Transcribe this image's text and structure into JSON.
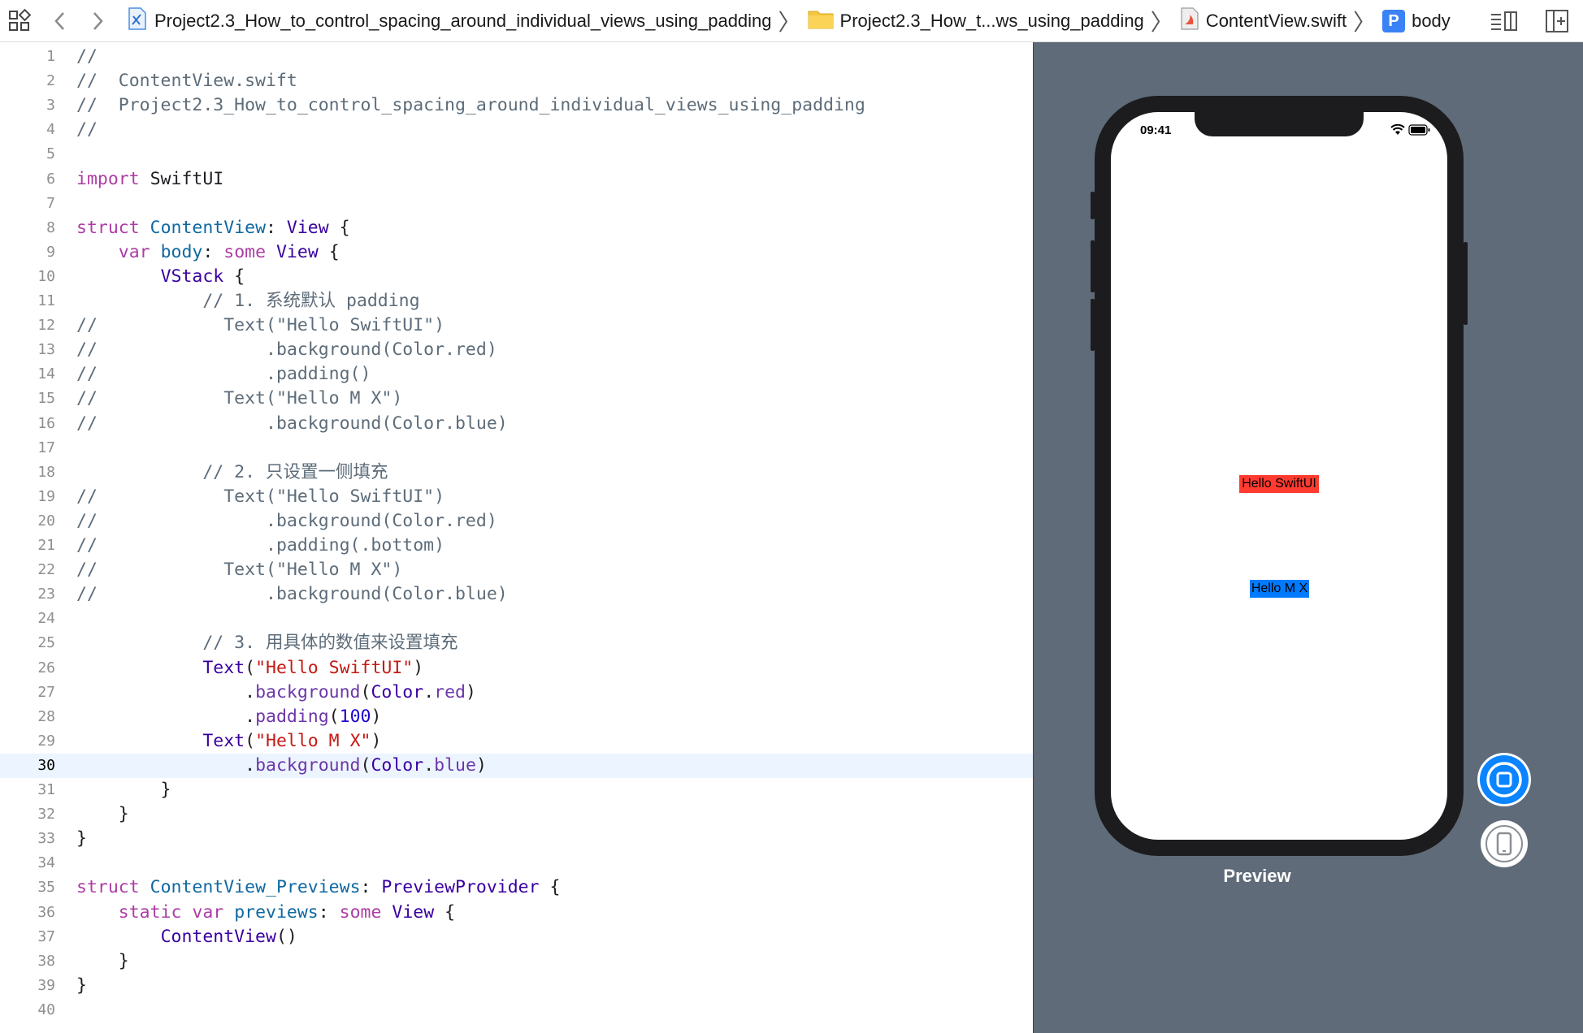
{
  "jumpbar": {
    "project": "Project2.3_How_to_control_spacing_around_individual_views_using_padding",
    "folder": "Project2.3_How_t...ws_using_padding",
    "file": "ContentView.swift",
    "symbol_badge": "P",
    "symbol": "body",
    "icons": [
      "grid-icon",
      "back-arrow-icon",
      "forward-arrow-icon",
      "xcode-project-icon",
      "folder-icon",
      "swift-file-icon",
      "property-icon",
      "editor-options-icon",
      "add-editor-icon"
    ]
  },
  "editor": {
    "current_line": 30,
    "lines": [
      {
        "n": "1",
        "t": [
          [
            "c",
            "//"
          ]
        ]
      },
      {
        "n": "2",
        "t": [
          [
            "c",
            "//  ContentView.swift"
          ]
        ]
      },
      {
        "n": "3",
        "t": [
          [
            "c",
            "//  Project2.3_How_to_control_spacing_around_individual_views_using_padding"
          ]
        ]
      },
      {
        "n": "4",
        "t": [
          [
            "c",
            "//"
          ]
        ]
      },
      {
        "n": "5",
        "t": []
      },
      {
        "n": "6",
        "t": [
          [
            "k",
            "import"
          ],
          [
            "p",
            " SwiftUI"
          ]
        ]
      },
      {
        "n": "7",
        "t": []
      },
      {
        "n": "8",
        "t": [
          [
            "k",
            "struct"
          ],
          [
            "p",
            " "
          ],
          [
            "d",
            "ContentView"
          ],
          [
            "p",
            ": "
          ],
          [
            "t",
            "View"
          ],
          [
            "p",
            " {"
          ]
        ]
      },
      {
        "n": "9",
        "t": [
          [
            "p",
            "    "
          ],
          [
            "k",
            "var"
          ],
          [
            "p",
            " "
          ],
          [
            "d",
            "body"
          ],
          [
            "p",
            ": "
          ],
          [
            "k",
            "some"
          ],
          [
            "p",
            " "
          ],
          [
            "t",
            "View"
          ],
          [
            "p",
            " {"
          ]
        ]
      },
      {
        "n": "10",
        "t": [
          [
            "p",
            "        "
          ],
          [
            "t",
            "VStack"
          ],
          [
            "p",
            " {"
          ]
        ]
      },
      {
        "n": "11",
        "t": [
          [
            "p",
            "            "
          ],
          [
            "c",
            "// 1. 系统默认 padding"
          ]
        ]
      },
      {
        "n": "12",
        "t": [
          [
            "c",
            "//            Text(\"Hello SwiftUI\")"
          ]
        ]
      },
      {
        "n": "13",
        "t": [
          [
            "c",
            "//                .background(Color.red)"
          ]
        ]
      },
      {
        "n": "14",
        "t": [
          [
            "c",
            "//                .padding()"
          ]
        ]
      },
      {
        "n": "15",
        "t": [
          [
            "c",
            "//            Text(\"Hello M X\")"
          ]
        ]
      },
      {
        "n": "16",
        "t": [
          [
            "c",
            "//                .background(Color.blue)"
          ]
        ]
      },
      {
        "n": "17",
        "t": []
      },
      {
        "n": "18",
        "t": [
          [
            "p",
            "            "
          ],
          [
            "c",
            "// 2. 只设置一侧填充"
          ]
        ]
      },
      {
        "n": "19",
        "t": [
          [
            "c",
            "//            Text(\"Hello SwiftUI\")"
          ]
        ]
      },
      {
        "n": "20",
        "t": [
          [
            "c",
            "//                .background(Color.red)"
          ]
        ]
      },
      {
        "n": "21",
        "t": [
          [
            "c",
            "//                .padding(.bottom)"
          ]
        ]
      },
      {
        "n": "22",
        "t": [
          [
            "c",
            "//            Text(\"Hello M X\")"
          ]
        ]
      },
      {
        "n": "23",
        "t": [
          [
            "c",
            "//                .background(Color.blue)"
          ]
        ]
      },
      {
        "n": "24",
        "t": []
      },
      {
        "n": "25",
        "t": [
          [
            "p",
            "            "
          ],
          [
            "c",
            "// 3. 用具体的数值来设置填充"
          ]
        ]
      },
      {
        "n": "26",
        "t": [
          [
            "p",
            "            "
          ],
          [
            "t",
            "Text"
          ],
          [
            "p",
            "("
          ],
          [
            "s",
            "\"Hello SwiftUI\""
          ],
          [
            "p",
            ")"
          ]
        ]
      },
      {
        "n": "27",
        "t": [
          [
            "p",
            "                ."
          ],
          [
            "m",
            "background"
          ],
          [
            "p",
            "("
          ],
          [
            "t",
            "Color"
          ],
          [
            "p",
            "."
          ],
          [
            "m",
            "red"
          ],
          [
            "p",
            ")"
          ]
        ]
      },
      {
        "n": "28",
        "t": [
          [
            "p",
            "                ."
          ],
          [
            "m",
            "padding"
          ],
          [
            "p",
            "("
          ],
          [
            "n",
            "100"
          ],
          [
            "p",
            ")"
          ]
        ]
      },
      {
        "n": "29",
        "t": [
          [
            "p",
            "            "
          ],
          [
            "t",
            "Text"
          ],
          [
            "p",
            "("
          ],
          [
            "s",
            "\"Hello M X\""
          ],
          [
            "p",
            ")"
          ]
        ]
      },
      {
        "n": "30",
        "t": [
          [
            "p",
            "                ."
          ],
          [
            "m",
            "background"
          ],
          [
            "p",
            "("
          ],
          [
            "t",
            "Color"
          ],
          [
            "p",
            "."
          ],
          [
            "m",
            "blue"
          ],
          [
            "p",
            ")"
          ]
        ]
      },
      {
        "n": "31",
        "t": [
          [
            "p",
            "        }"
          ]
        ]
      },
      {
        "n": "32",
        "t": [
          [
            "p",
            "    }"
          ]
        ]
      },
      {
        "n": "33",
        "t": [
          [
            "p",
            "}"
          ]
        ]
      },
      {
        "n": "34",
        "t": []
      },
      {
        "n": "35",
        "t": [
          [
            "k",
            "struct"
          ],
          [
            "p",
            " "
          ],
          [
            "d",
            "ContentView_Previews"
          ],
          [
            "p",
            ": "
          ],
          [
            "t",
            "PreviewProvider"
          ],
          [
            "p",
            " {"
          ]
        ]
      },
      {
        "n": "36",
        "t": [
          [
            "p",
            "    "
          ],
          [
            "k",
            "static"
          ],
          [
            "p",
            " "
          ],
          [
            "k",
            "var"
          ],
          [
            "p",
            " "
          ],
          [
            "d",
            "previews"
          ],
          [
            "p",
            ": "
          ],
          [
            "k",
            "some"
          ],
          [
            "p",
            " "
          ],
          [
            "t",
            "View"
          ],
          [
            "p",
            " {"
          ]
        ]
      },
      {
        "n": "37",
        "t": [
          [
            "p",
            "        "
          ],
          [
            "t",
            "ContentView"
          ],
          [
            "p",
            "()"
          ]
        ]
      },
      {
        "n": "38",
        "t": [
          [
            "p",
            "    }"
          ]
        ]
      },
      {
        "n": "39",
        "t": [
          [
            "p",
            "}"
          ]
        ]
      },
      {
        "n": "40",
        "t": []
      }
    ]
  },
  "preview": {
    "status_time": "09:41",
    "text_red": "Hello SwiftUI",
    "text_blue": "Hello M X",
    "caption": "Preview",
    "colors": {
      "background": "#5f6b78",
      "red": "#ff3b30",
      "blue": "#007aff",
      "live_button": "#0a84ff"
    },
    "controls": [
      "live-preview-button",
      "device-preview-button"
    ]
  }
}
